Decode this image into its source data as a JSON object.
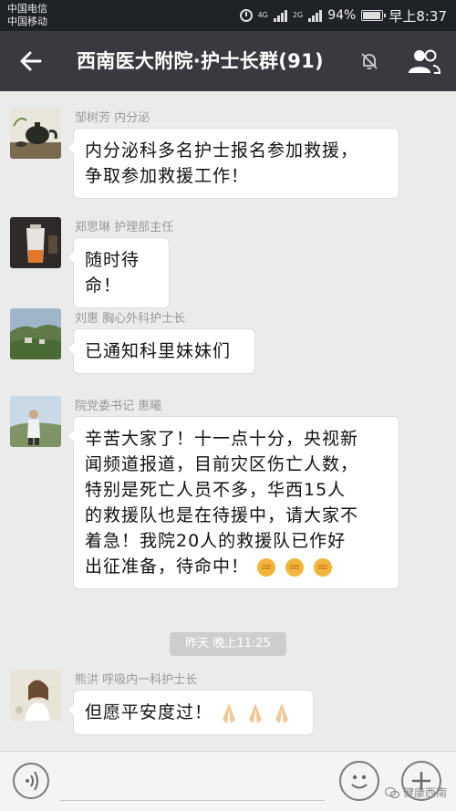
{
  "status_bar": {
    "carrier_1": "中国电信",
    "carrier_2": "中国移动",
    "network_1": "4G",
    "network_2": "2G",
    "battery": "94%",
    "time": "早上8:37"
  },
  "header": {
    "title": "西南医大附院·护士长群(91)"
  },
  "messages": [
    {
      "sender": "邹树芳 内分泌",
      "lines": [
        "内分泌科多名护士报名参加救援，",
        "争取参加救援工作！"
      ]
    },
    {
      "sender": "郑思琳 护理部主任",
      "lines": [
        "随时待命！"
      ]
    },
    {
      "sender": "刘惠 胸心外科护士长",
      "lines": [
        "已通知科里妹妹们"
      ]
    },
    {
      "sender": "院党委书记 惠曦",
      "lines": [
        "辛苦大家了！十一点十分，央视新",
        "闻频道报道，目前灾区伤亡人数，",
        "特别是死亡人员不多，华西15人",
        "的救援队也是在待援中，请大家不",
        "着急！我院20人的救援队已作好",
        "出征准备，待命中！"
      ]
    },
    {
      "sender": "熊洪 呼吸内一科护士长",
      "lines": [
        "但愿平安度过！"
      ]
    }
  ],
  "timestamp": "昨天 晚上11:25",
  "emojis": {
    "fist_count": 3,
    "pray_count": 3
  },
  "watermark": "健康西南",
  "colors": {
    "header_bg": "#393a3f",
    "status_bg": "#1f2227",
    "chat_bg": "#ebebeb",
    "bubble_bg": "#ffffff"
  }
}
